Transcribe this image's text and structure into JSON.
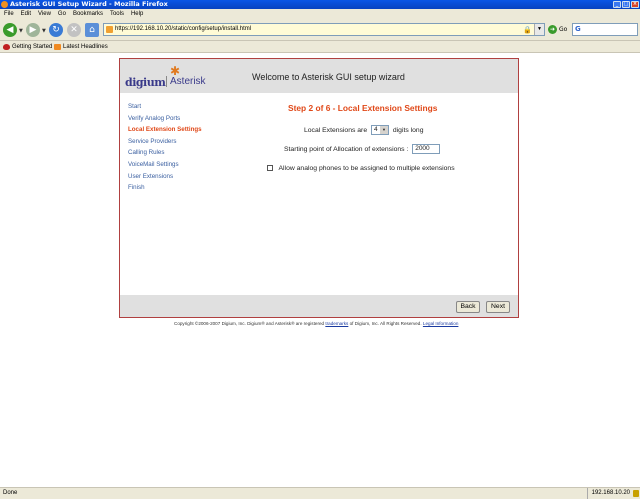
{
  "window": {
    "title": "Asterisk GUI Setup Wizard - Mozilla Firefox"
  },
  "menu": {
    "items": [
      "File",
      "Edit",
      "View",
      "Go",
      "Bookmarks",
      "Tools",
      "Help"
    ]
  },
  "toolbar": {
    "url": "https://192.168.10.20/static/config/setup/install.html",
    "go_label": "Go",
    "search_value": "G"
  },
  "bookmarks": {
    "getting_started": "Getting Started",
    "latest_headlines": "Latest Headlines"
  },
  "wizard": {
    "logo_left": "digium",
    "logo_right": "Asterisk",
    "title": "Welcome to Asterisk GUI setup wizard",
    "steps": [
      "Start",
      "Verify Analog Ports",
      "Local Extension Settings",
      "Service Providers",
      "Calling Rules",
      "VoiceMail Settings",
      "User Extensions",
      "Finish"
    ],
    "active_step": 2,
    "step_title": "Step 2 of 6  - Local Extension Settings",
    "ext_label_before": "Local Extensions are",
    "ext_digits_value": "4",
    "ext_label_after": "digits long",
    "start_label": "Starting point of Allocation of extensions :",
    "start_value": "2000",
    "multi_label": "Allow analog phones to be assigned to multiple extensions",
    "multi_checked": false,
    "back_label": "Back",
    "next_label": "Next"
  },
  "copyright": {
    "text_before": "Copyright ©2006-2007 Digium, Inc.  Digium® and Asterisk® are registered",
    "trademarks": "trademarks",
    "text_after": "of Digium, Inc.  All Rights Reserved.",
    "legal": "Legal Information"
  },
  "status": {
    "text": "Done",
    "ip": "192.168.10.20"
  }
}
